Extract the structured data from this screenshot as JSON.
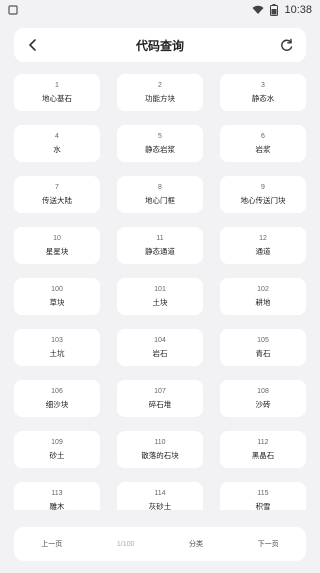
{
  "status_bar": {
    "time": "10:38",
    "battery": ""
  },
  "header": {
    "title": "代码查询"
  },
  "cards": [
    {
      "id": "1",
      "name": "地心基石"
    },
    {
      "id": "2",
      "name": "功能方块"
    },
    {
      "id": "3",
      "name": "静态水"
    },
    {
      "id": "4",
      "name": "水"
    },
    {
      "id": "5",
      "name": "静态岩浆"
    },
    {
      "id": "6",
      "name": "岩浆"
    },
    {
      "id": "7",
      "name": "传送大陆"
    },
    {
      "id": "8",
      "name": "地心门框"
    },
    {
      "id": "9",
      "name": "地心传送门块"
    },
    {
      "id": "10",
      "name": "星星块"
    },
    {
      "id": "11",
      "name": "静态通道"
    },
    {
      "id": "12",
      "name": "通道"
    },
    {
      "id": "100",
      "name": "草块"
    },
    {
      "id": "101",
      "name": "土块"
    },
    {
      "id": "102",
      "name": "耕地"
    },
    {
      "id": "103",
      "name": "土坑"
    },
    {
      "id": "104",
      "name": "岩石"
    },
    {
      "id": "105",
      "name": "青石"
    },
    {
      "id": "106",
      "name": "细沙块"
    },
    {
      "id": "107",
      "name": "碎石堆"
    },
    {
      "id": "108",
      "name": "沙砖"
    },
    {
      "id": "109",
      "name": "砂土"
    },
    {
      "id": "110",
      "name": "散落的石块"
    },
    {
      "id": "112",
      "name": "黑晶石"
    },
    {
      "id": "113",
      "name": "雕木"
    },
    {
      "id": "114",
      "name": "灰砂土"
    },
    {
      "id": "115",
      "name": "积雪"
    }
  ],
  "footer": {
    "prev_label": "上一页",
    "page_label": "1/100",
    "category_label": "分类",
    "next_label": "下一页"
  }
}
